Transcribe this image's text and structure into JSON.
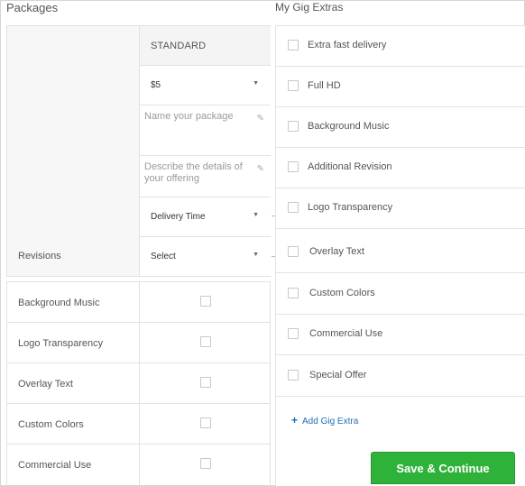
{
  "packages": {
    "title": "Packages",
    "tier_header": "STANDARD",
    "price": "$5",
    "name_placeholder": "Name your package",
    "description_placeholder": "Describe the details of your offering",
    "delivery_time": "Delivery Time",
    "revisions_label": "Revisions",
    "revisions_value": "Select",
    "features": [
      {
        "label": "Background Music",
        "checked": false
      },
      {
        "label": "Logo Transparency",
        "checked": false
      },
      {
        "label": "Overlay Text",
        "checked": false
      },
      {
        "label": "Custom Colors",
        "checked": false
      },
      {
        "label": "Commercial Use",
        "checked": false
      }
    ]
  },
  "extras": {
    "title": "My Gig Extras",
    "items": [
      {
        "label": "Extra fast delivery",
        "checked": false
      },
      {
        "label": "Full HD",
        "checked": false
      },
      {
        "label": "Background Music",
        "checked": false
      },
      {
        "label": "Additional Revision",
        "checked": false
      },
      {
        "label": "Logo Transparency",
        "checked": false
      },
      {
        "label": "Overlay Text",
        "checked": false
      },
      {
        "label": "Custom Colors",
        "checked": false
      },
      {
        "label": "Commercial Use",
        "checked": false
      },
      {
        "label": "Special Offer",
        "checked": false
      }
    ],
    "add_label": "Add Gig Extra"
  },
  "actions": {
    "save_label": "Save & Continue"
  },
  "colors": {
    "accent_green": "#2fb23a",
    "link_blue": "#1f6fb5"
  }
}
